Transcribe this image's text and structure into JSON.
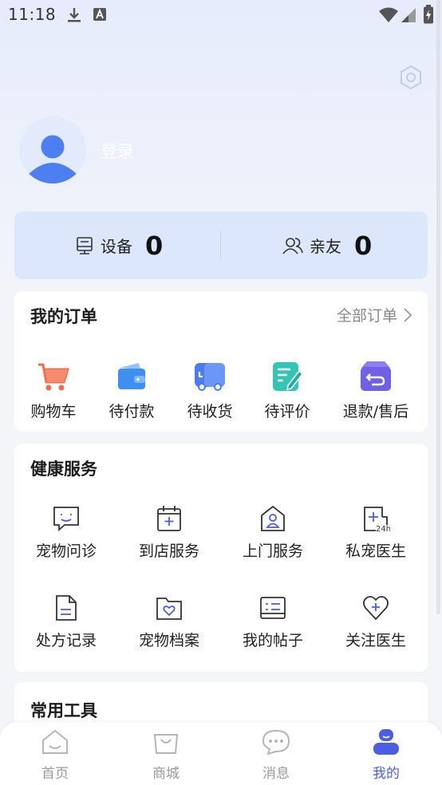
{
  "status_bar": {
    "time": "11:18",
    "left_icons": [
      "download-icon",
      "a-box-icon"
    ],
    "right_icons": [
      "wifi-icon",
      "signal-icon",
      "battery-charging-icon"
    ]
  },
  "header": {
    "settings_icon": "gear-icon",
    "avatar_icon": "user-avatar-icon",
    "login_label": "登录"
  },
  "stats": {
    "devices": {
      "icon": "device-icon",
      "label": "设备",
      "count": "0"
    },
    "friends": {
      "icon": "friends-icon",
      "label": "亲友",
      "count": "0"
    }
  },
  "orders": {
    "title": "我的订单",
    "all_label": "全部订单",
    "items": [
      {
        "label": "购物车",
        "icon": "cart-icon",
        "color": "#f26b4f"
      },
      {
        "label": "待付款",
        "icon": "wallet-icon",
        "color": "#3f8ff0"
      },
      {
        "label": "待收货",
        "icon": "truck-icon",
        "color": "#4a7cf0"
      },
      {
        "label": "待评价",
        "icon": "review-icon",
        "color": "#33c4b6"
      },
      {
        "label": "退款/售后",
        "icon": "refund-icon",
        "color": "#7060e6"
      }
    ]
  },
  "health": {
    "title": "健康服务",
    "items": [
      {
        "label": "宠物问诊",
        "icon": "chat-smile-icon"
      },
      {
        "label": "到店服务",
        "icon": "calendar-plus-icon"
      },
      {
        "label": "上门服务",
        "icon": "house-person-icon"
      },
      {
        "label": "私宠医生",
        "icon": "doctor-24h-icon"
      },
      {
        "label": "处方记录",
        "icon": "document-icon"
      },
      {
        "label": "宠物档案",
        "icon": "folder-heart-icon"
      },
      {
        "label": "我的帖子",
        "icon": "post-icon"
      },
      {
        "label": "关注医生",
        "icon": "heart-plus-icon"
      }
    ]
  },
  "tools": {
    "title": "常用工具"
  },
  "tabbar": {
    "tabs": [
      {
        "label": "首页",
        "icon": "home-icon",
        "active": false
      },
      {
        "label": "商城",
        "icon": "shopping-bag-icon",
        "active": false
      },
      {
        "label": "消息",
        "icon": "message-icon",
        "active": false
      },
      {
        "label": "我的",
        "icon": "profile-icon",
        "active": true
      }
    ],
    "active_color": "#4b5de0",
    "inactive_color": "#9a9a9a"
  }
}
